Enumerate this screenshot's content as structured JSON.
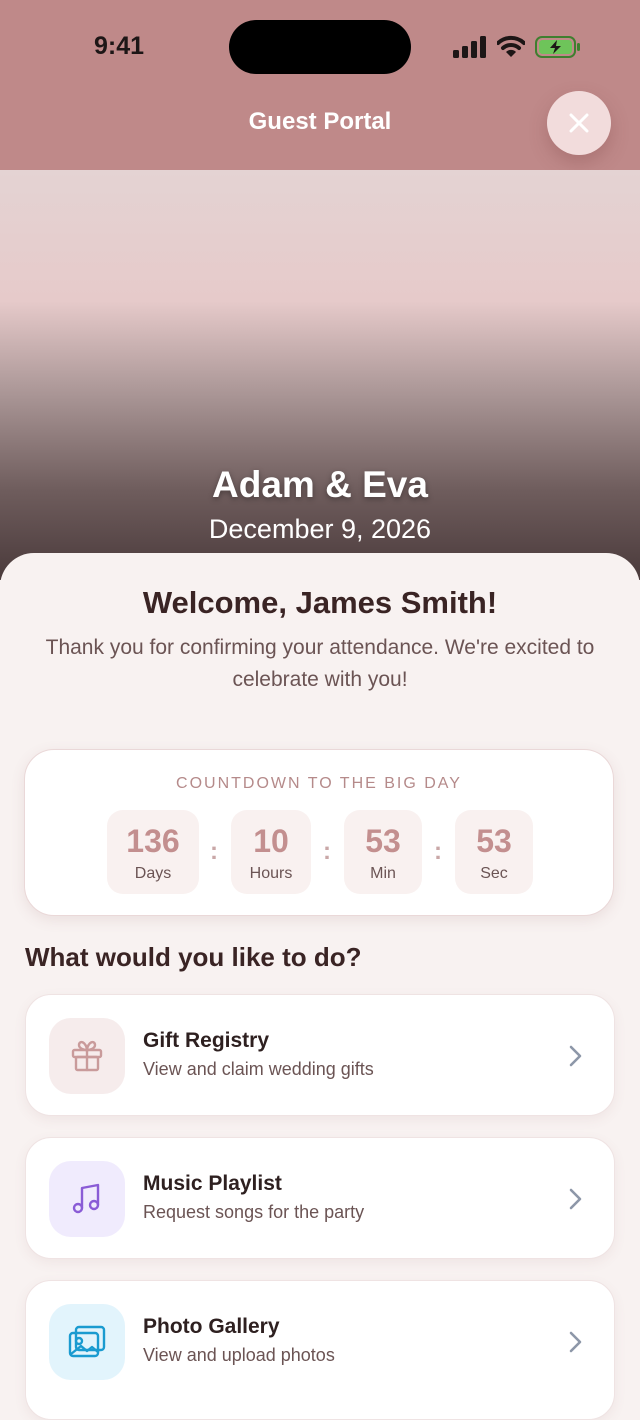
{
  "status_bar": {
    "time": "9:41"
  },
  "header": {
    "title": "Guest Portal"
  },
  "hero": {
    "couple": "Adam & Eva",
    "date": "December 9, 2026"
  },
  "welcome": {
    "title": "Welcome, James Smith!",
    "message": "Thank you for confirming your attendance. We're excited to celebrate with you!"
  },
  "countdown": {
    "label": "COUNTDOWN TO THE BIG DAY",
    "units": [
      {
        "value": "136",
        "label": "Days"
      },
      {
        "value": "10",
        "label": "Hours"
      },
      {
        "value": "53",
        "label": "Min"
      },
      {
        "value": "53",
        "label": "Sec"
      }
    ],
    "separator": ":"
  },
  "actions": {
    "title": "What would you like to do?",
    "items": [
      {
        "title": "Gift Registry",
        "subtitle": "View and claim wedding gifts",
        "icon": "gift-icon",
        "icon_bg": "#f6ecec",
        "icon_color": "#c99b9b"
      },
      {
        "title": "Music Playlist",
        "subtitle": "Request songs for the party",
        "icon": "music-note-icon",
        "icon_bg": "#f0ebfd",
        "icon_color": "#8a5cd6"
      },
      {
        "title": "Photo Gallery",
        "subtitle": "View and upload photos",
        "icon": "image-icon",
        "icon_bg": "#e2f4fc",
        "icon_color": "#1a9bd0"
      }
    ]
  },
  "colors": {
    "header": "#bf8989",
    "accent": "#c38f8f",
    "background": "#f8f2f1"
  }
}
